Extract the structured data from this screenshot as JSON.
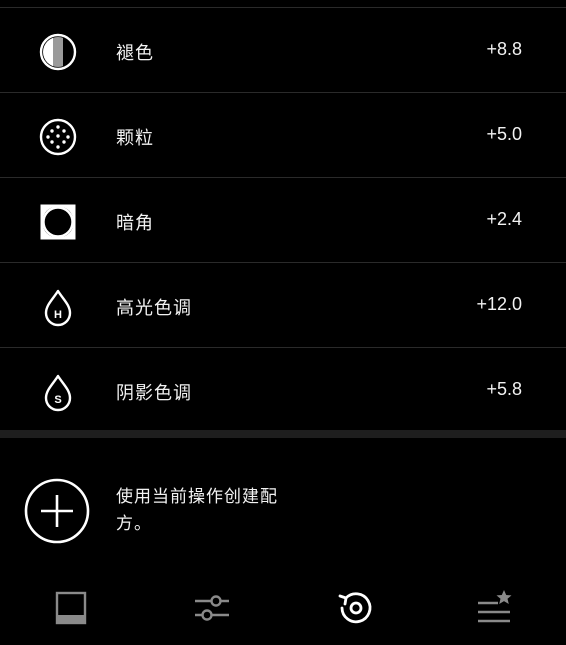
{
  "adjustments": [
    {
      "label": "褪色",
      "value": "+8.8",
      "icon": "fade-icon"
    },
    {
      "label": "颗粒",
      "value": "+5.0",
      "icon": "grain-icon"
    },
    {
      "label": "暗角",
      "value": "+2.4",
      "icon": "vignette-icon"
    },
    {
      "label": "高光色调",
      "value": "+12.0",
      "icon": "highlight-tone-icon"
    },
    {
      "label": "阴影色调",
      "value": "+5.8",
      "icon": "shadow-tone-icon"
    }
  ],
  "preset": {
    "text": "使用当前操作创建配方。"
  },
  "tabs": [
    {
      "name": "presets-tab",
      "icon": "frame-icon",
      "active": false
    },
    {
      "name": "tools-tab",
      "icon": "sliders-icon",
      "active": false
    },
    {
      "name": "history-tab",
      "icon": "history-icon",
      "active": true
    },
    {
      "name": "recipes-tab",
      "icon": "recipe-star-icon",
      "active": false
    }
  ]
}
